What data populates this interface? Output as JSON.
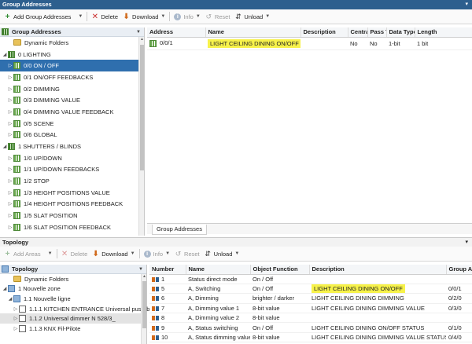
{
  "ga": {
    "title": "Group Addresses",
    "toolbar": {
      "add": "Add Group Addresses",
      "delete": "Delete",
      "download": "Download",
      "info": "Info",
      "reset": "Reset",
      "unload": "Unload"
    },
    "tree_header": "Group Addresses",
    "tree": [
      {
        "label": "Dynamic Folders",
        "icon": "folder",
        "indent": 1,
        "exp": ""
      },
      {
        "label": "0 LIGHTING",
        "icon": "group-wide",
        "indent": 0,
        "exp": "◢"
      },
      {
        "label": "0/0 ON / OFF",
        "icon": "group",
        "indent": 1,
        "exp": "▷",
        "selected": true
      },
      {
        "label": "0/1 ON/OFF FEEDBACKS",
        "icon": "group",
        "indent": 1,
        "exp": "▷"
      },
      {
        "label": "0/2 DIMMING",
        "icon": "group",
        "indent": 1,
        "exp": "▷"
      },
      {
        "label": "0/3 DIMMING VALUE",
        "icon": "group",
        "indent": 1,
        "exp": "▷"
      },
      {
        "label": "0/4 DIMMING VALUE FEEDBACK",
        "icon": "group",
        "indent": 1,
        "exp": "▷"
      },
      {
        "label": "0/5 SCENE",
        "icon": "group",
        "indent": 1,
        "exp": "▷"
      },
      {
        "label": "0/6 GLOBAL",
        "icon": "group",
        "indent": 1,
        "exp": "▷"
      },
      {
        "label": "1 SHUTTERS / BLINDS",
        "icon": "group-wide",
        "indent": 0,
        "exp": "◢"
      },
      {
        "label": "1/0 UP/DOWN",
        "icon": "group",
        "indent": 1,
        "exp": "▷"
      },
      {
        "label": "1/1 UP/DOWN FEEDBACKS",
        "icon": "group",
        "indent": 1,
        "exp": "▷"
      },
      {
        "label": "1/2 STOP",
        "icon": "group",
        "indent": 1,
        "exp": "▷"
      },
      {
        "label": "1/3 HEIGHT POSITIONS VALUE",
        "icon": "group",
        "indent": 1,
        "exp": "▷"
      },
      {
        "label": "1/4 HEIGHT POSITIONS FEEDBACK",
        "icon": "group",
        "indent": 1,
        "exp": "▷"
      },
      {
        "label": "1/5 SLAT POSITION",
        "icon": "group",
        "indent": 1,
        "exp": "▷"
      },
      {
        "label": "1/6 SLAT POSITION FEEDBACK",
        "icon": "group",
        "indent": 1,
        "exp": "▷"
      }
    ],
    "columns": [
      "Address",
      "Name",
      "Description",
      "Central",
      "Pass T",
      "Data Type",
      "Length"
    ],
    "rows": [
      {
        "address": "0/0/1",
        "name": "LIGHT CEILING DINING ON/OFF",
        "description": "",
        "central": "No",
        "pass": "No",
        "datatype": "1-bit",
        "length": "1 bit"
      }
    ],
    "tab": "Group Addresses"
  },
  "topo": {
    "title": "Topology",
    "toolbar": {
      "add": "Add Areas",
      "delete": "Delete",
      "download": "Download",
      "info": "Info",
      "reset": "Reset",
      "unload": "Unload"
    },
    "tree_header": "Topology",
    "tree": [
      {
        "label": "Dynamic Folders",
        "icon": "folder",
        "indent": 1,
        "exp": ""
      },
      {
        "label": "1 Nouvelle zone",
        "icon": "building",
        "indent": 0,
        "exp": "◢"
      },
      {
        "label": "1.1 Nouvelle ligne",
        "icon": "line",
        "indent": 1,
        "exp": "◢"
      },
      {
        "label": "1.1.1 KITCHEN ENTRANCE Universal push-but...",
        "icon": "device",
        "indent": 2,
        "exp": "▷"
      },
      {
        "label": "1.1.2 Universal dimmer N 528/3_",
        "icon": "device",
        "indent": 2,
        "exp": "▷",
        "selected_light": true
      },
      {
        "label": "1.1.3 KNX Fil-Pilote",
        "icon": "device",
        "indent": 2,
        "exp": "▷"
      }
    ],
    "columns": [
      "Number",
      "Name",
      "Object Function",
      "Description",
      "Group Add"
    ],
    "rows": [
      {
        "number": "1",
        "name": "Status direct mode",
        "function": "On / Off",
        "description": "",
        "group": ""
      },
      {
        "number": "5",
        "name": "A, Switching",
        "function": "On / Off",
        "description": "LIGHT CEILING DINING ON/OFF",
        "group": "0/0/1",
        "hl": true
      },
      {
        "number": "6",
        "name": "A, Dimming",
        "function": "brighter / darker",
        "description": "LIGHT CEILING DINING DIMMING",
        "group": "0/2/0"
      },
      {
        "number": "7",
        "name": "A, Dimming value 1",
        "function": "8-bit value",
        "description": "LIGHT CEILING DINING DIMMING VALUE",
        "group": "0/3/0"
      },
      {
        "number": "8",
        "name": "A, Dimming value 2",
        "function": "8-bit value",
        "description": "",
        "group": ""
      },
      {
        "number": "9",
        "name": "A, Status switching",
        "function": "On / Off",
        "description": "LIGHT CEILING DINING ON/OFF STATUS",
        "group": "0/1/0"
      },
      {
        "number": "10",
        "name": "A, Status dimming value",
        "function": "8-bit value",
        "description": "LIGHT CEILING DINING DIMMING VALUE STATUS",
        "group": "0/4/0"
      }
    ]
  },
  "colors": {
    "titlebar": "#2d5f8e",
    "selection": "#2f6fae",
    "highlight": "#f7f24a"
  }
}
